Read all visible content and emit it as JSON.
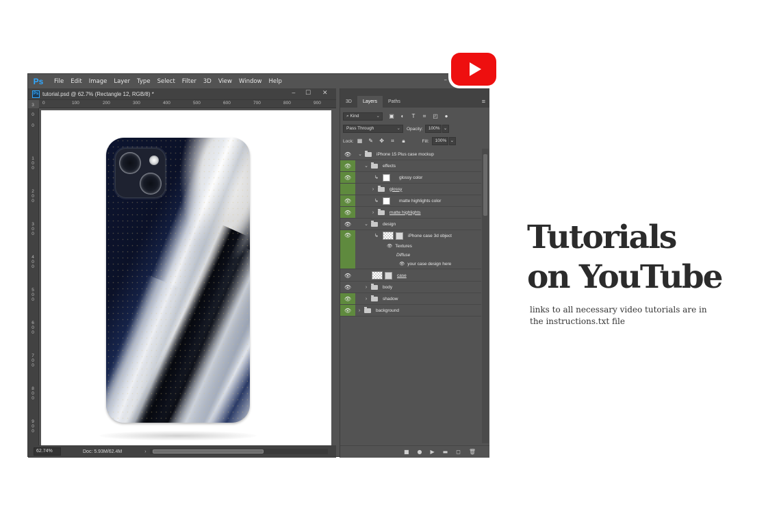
{
  "menubar": {
    "logo": "Ps",
    "items": [
      "File",
      "Edit",
      "Image",
      "Layer",
      "Type",
      "Select",
      "Filter",
      "3D",
      "View",
      "Window",
      "Help"
    ],
    "window_controls": "–"
  },
  "document": {
    "tab_title": "tutorial.psd @ 62.7% (Rectangle 12, RGB/8) *",
    "ruler_h": [
      "0",
      "100",
      "200",
      "300",
      "400",
      "500",
      "600",
      "700",
      "800",
      "900"
    ],
    "ruler_v": [
      "0",
      "1 0 0",
      "2 0 0",
      "3 0 0",
      "4 0 0",
      "5 0 0",
      "6 0 0",
      "7 0 0",
      "8 0 0",
      "9 0 0"
    ],
    "zoom": "62.74%",
    "doc_size": "Doc: 5.93M/62.4M"
  },
  "panel": {
    "tabs": [
      "3D",
      "Layers",
      "Paths"
    ],
    "active_tab": "Layers",
    "filter_kind": "Kind",
    "blend_mode": "Pass Through",
    "opacity_label": "Opacity:",
    "opacity_value": "100%",
    "lock_label": "Lock:",
    "fill_label": "Fill:",
    "fill_value": "100%",
    "layers": [
      {
        "name": "iPhone 15 Plus case mockup",
        "type": "group",
        "eye": "visible"
      },
      {
        "name": "effects",
        "type": "group",
        "eye": "green"
      },
      {
        "name": "glossy color",
        "type": "fill",
        "eye": "green"
      },
      {
        "name": "glossy",
        "type": "group",
        "eye": "green-hidden"
      },
      {
        "name": "matte highlights color",
        "type": "fill",
        "eye": "green"
      },
      {
        "name": "matte highlights",
        "type": "group",
        "eye": "green"
      },
      {
        "name": "design",
        "type": "group",
        "eye": "visible"
      },
      {
        "name": "iPhone case 3d object",
        "type": "smart",
        "eye": "green"
      },
      {
        "name": "Textures",
        "type": "sub"
      },
      {
        "name": "Diffuse",
        "type": "sub"
      },
      {
        "name": "your case design here",
        "type": "sub"
      },
      {
        "name": "case",
        "type": "smart",
        "eye": "visible"
      },
      {
        "name": "body",
        "type": "group",
        "eye": "visible"
      },
      {
        "name": "shadow",
        "type": "group",
        "eye": "green"
      },
      {
        "name": "background",
        "type": "group",
        "eye": "green"
      }
    ]
  },
  "headline": {
    "line1": "Tutorials",
    "line2": "on YouTube"
  },
  "subtext": "links to all necessary video tutorials are in the instructions.txt file",
  "colors": {
    "ps_gray": "#535353",
    "ps_dark": "#424242",
    "layer_green": "#5f8a3e",
    "youtube_red": "#ee0f0f",
    "headline": "#2b2b2b"
  }
}
